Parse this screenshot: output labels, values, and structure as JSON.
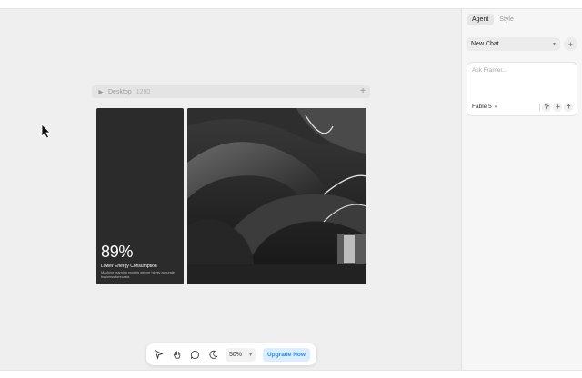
{
  "frame": {
    "name": "Desktop",
    "width_label": "1200",
    "add_icon": "plus-icon"
  },
  "card": {
    "stat": "89%",
    "title": "Lower Energy Consumption",
    "description": "Machine learning models deliver highly accurate business forecasts"
  },
  "toolbar": {
    "tools": [
      "cursor-icon",
      "hand-icon",
      "comment-icon",
      "moon-icon"
    ],
    "zoom": "50%",
    "upgrade_label": "Upgrade Now"
  },
  "panel": {
    "tabs": [
      {
        "label": "Agent",
        "active": true
      },
      {
        "label": "Style",
        "active": false
      }
    ],
    "chat_select": "New Chat",
    "input_placeholder": "Ask Framer...",
    "model": "Fable 5"
  },
  "colors": {
    "canvas": "#efefef",
    "dark_card": "#2b2b2b",
    "upgrade_bg": "#dbeeff",
    "upgrade_text": "#2b8be6"
  }
}
